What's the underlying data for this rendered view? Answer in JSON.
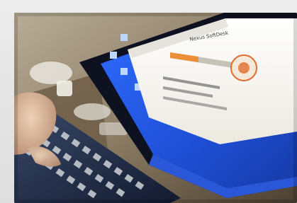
{
  "photo": {
    "subject": "laptop-screen-with-keyboard",
    "screen_dialog_title": "Nexus SoftDesk"
  },
  "colors": {
    "frame": "#e4e4e4",
    "desktop_blue": "#1f4fd6",
    "dialog_white": "#f6f5f1",
    "keyboard": "#1b2a4a",
    "hand_skin": "#d9b79a",
    "table_wood": "#7a6a52",
    "taskbar": "#2a56d8"
  }
}
